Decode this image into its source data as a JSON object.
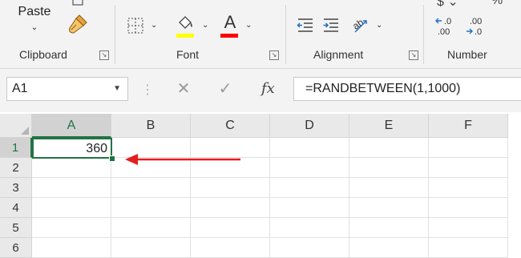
{
  "ribbon": {
    "clipboard": {
      "paste_label": "Paste",
      "group_label": "Clipboard"
    },
    "font": {
      "group_label": "Font",
      "highlight_color": "#ffff00",
      "font_color": "#ff0000"
    },
    "alignment": {
      "group_label": "Alignment"
    },
    "number": {
      "group_label": "Number",
      "increase_decimal": ".0\n.00",
      "decrease_decimal": ".00\n.0"
    }
  },
  "formula_bar": {
    "name_box": "A1",
    "fx_label": "fx",
    "formula": "=RANDBETWEEN(1,1000)"
  },
  "grid": {
    "columns": [
      "A",
      "B",
      "C",
      "D",
      "E",
      "F"
    ],
    "rows": [
      "1",
      "2",
      "3",
      "4",
      "5",
      "6"
    ],
    "cells": {
      "A1": "360"
    },
    "selected_cell": "A1"
  },
  "annotation": {
    "arrow_color": "#e41e1e"
  },
  "colors": {
    "accent": "#217346"
  }
}
